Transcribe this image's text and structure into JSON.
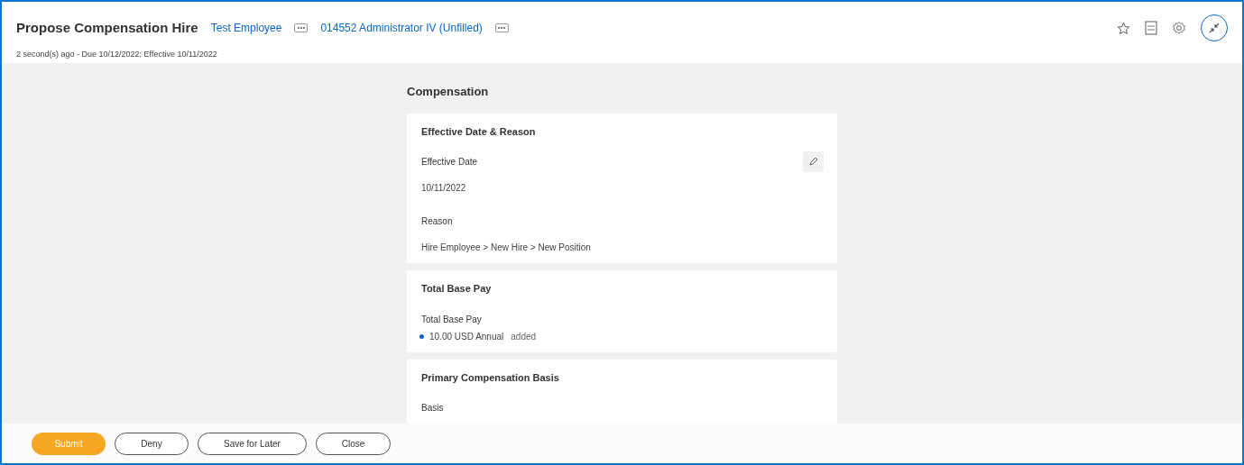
{
  "header": {
    "title": "Propose Compensation Hire",
    "links": [
      {
        "label": "Test Employee"
      },
      {
        "label": "014552 Administrator IV (Unfilled)"
      }
    ],
    "subtitle": "2 second(s) ago - Due 10/12/2022; Effective 10/11/2022"
  },
  "section_title": "Compensation",
  "cards": [
    {
      "title": "Effective Date & Reason",
      "editable": true,
      "fields": [
        {
          "label": "Effective Date",
          "value": "10/11/2022"
        },
        {
          "label": "Reason",
          "value": "Hire Employee > New Hire > New Position"
        }
      ]
    },
    {
      "title": "Total Base Pay",
      "editable": false,
      "fields": [
        {
          "label": "Total Base Pay",
          "value": "10.00 USD Annual",
          "note": "added",
          "color": "#0b65c8"
        }
      ]
    },
    {
      "title": "Primary Compensation Basis",
      "editable": false,
      "fields": [
        {
          "label": "Basis"
        }
      ]
    }
  ],
  "buttons": [
    {
      "label": "Submit",
      "kind": "primary"
    },
    {
      "label": "Deny",
      "kind": "secondary"
    },
    {
      "label": "Save for Later",
      "kind": "secondary"
    },
    {
      "label": "Close",
      "kind": "secondary"
    }
  ]
}
